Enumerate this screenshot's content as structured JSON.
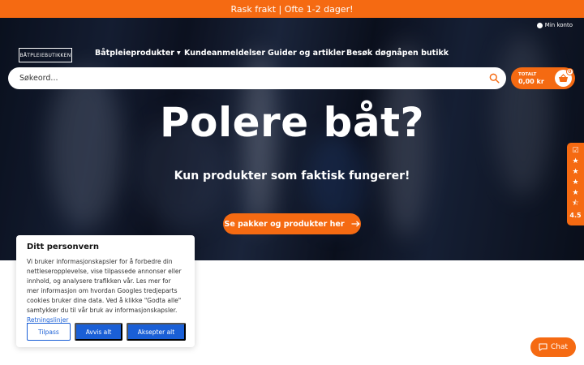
{
  "topbar": {
    "text": "Rask frakt | Ofte 1-2 dager!"
  },
  "logo": {
    "text": "BÅTPLEIEBUTIKKEN"
  },
  "account": {
    "label": "Min konto"
  },
  "nav": [
    {
      "label": "Båtpleieprodukter",
      "dropdown": true
    },
    {
      "label": "Kundeanmeldelser"
    },
    {
      "label": "Guider og artikler"
    },
    {
      "label": "Besøk døgnåpen butikk"
    }
  ],
  "search": {
    "placeholder": "Søkeord..."
  },
  "cart": {
    "total_label": "TOTALT",
    "total_value": "0,00 kr",
    "count": "0"
  },
  "hero": {
    "headline": "Polere båt?",
    "subline": "Kun produkter som faktisk fungerer!",
    "cta_label": "Se pakker og produkter her"
  },
  "rating": {
    "score": "4.5",
    "stars": 4.5
  },
  "cookie": {
    "title": "Ditt personvern",
    "body": "Vi bruker informasjonskapsler for å forbedre din nettleseropplevelse, vise tilpassede annonser eller innhold, og analysere trafikken vår. Les mer for mer informasjon om hvordan Googles tredjeparts cookies bruker dine data. Ved å klikke \"Godta alle\" samtykker du til vår bruk av informasjonskapsler.",
    "policy_link": "Retningslinjer",
    "customize_label": "Tilpass",
    "reject_label": "Avvis alt",
    "accept_label": "Aksepter alt"
  },
  "chat": {
    "label": "Chat"
  },
  "colors": {
    "brand_orange": "#f56a12",
    "consent_blue": "#1a5fd6"
  }
}
